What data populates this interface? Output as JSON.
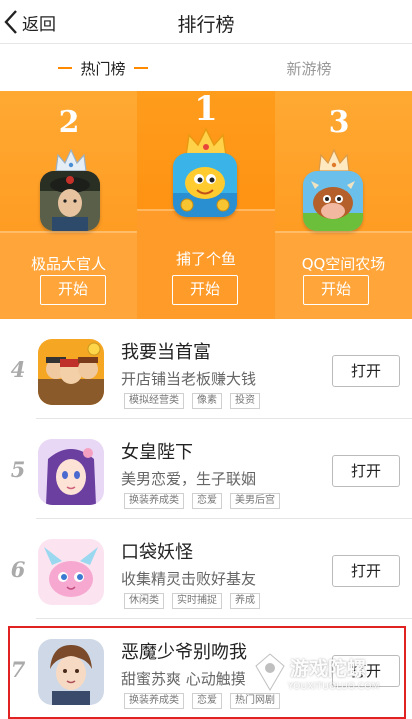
{
  "header": {
    "back_label": "返回",
    "title": "排行榜"
  },
  "tabs": [
    {
      "label": "热门榜",
      "active": true
    },
    {
      "label": "新游榜",
      "active": false
    }
  ],
  "colors": {
    "accent": "#ff8a00",
    "podium": "#ff9a1f",
    "highlight_border": "#e02222"
  },
  "podium": [
    {
      "rank": "1",
      "name": "捕了个鱼",
      "button": "开始"
    },
    {
      "rank": "2",
      "name": "极品大官人",
      "button": "开始"
    },
    {
      "rank": "3",
      "name": "QQ空间农场",
      "button": "开始"
    }
  ],
  "list": [
    {
      "rank": "4",
      "title": "我要当首富",
      "desc": "开店铺当老板赚大钱",
      "tags": [
        "模拟经营类",
        "像素",
        "投资"
      ],
      "button": "打开"
    },
    {
      "rank": "5",
      "title": "女皇陛下",
      "desc": "美男恋爱，生子联姻",
      "tags": [
        "换装养成类",
        "恋爱",
        "美男后宫"
      ],
      "button": "打开"
    },
    {
      "rank": "6",
      "title": "口袋妖怪",
      "desc": "收集精灵击败好基友",
      "tags": [
        "休闲类",
        "实时捕捉",
        "养成"
      ],
      "button": "打开"
    },
    {
      "rank": "7",
      "title": "恶魔少爷别吻我",
      "desc": "甜蜜苏爽 心动触摸",
      "tags": [
        "换装养成类",
        "恋爱",
        "热门网剧"
      ],
      "button": "打开"
    }
  ],
  "watermark": {
    "text": "游戏陀螺",
    "url": "YOUXITUOLUO.COM"
  }
}
